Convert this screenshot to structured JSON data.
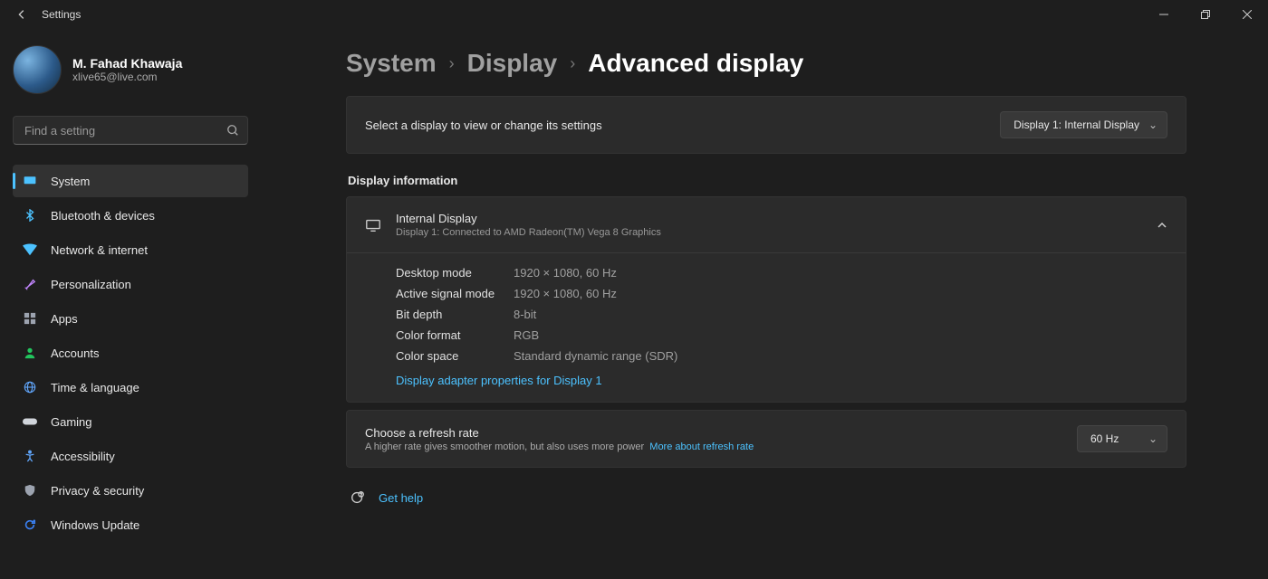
{
  "titlebar": {
    "title": "Settings"
  },
  "profile": {
    "name": "M. Fahad Khawaja",
    "email": "xlive65@live.com"
  },
  "search": {
    "placeholder": "Find a setting"
  },
  "nav": [
    {
      "id": "system",
      "label": "System",
      "active": true,
      "color": "#4cc2ff",
      "icon": "monitor"
    },
    {
      "id": "bluetooth",
      "label": "Bluetooth & devices",
      "color": "#4cc2ff",
      "icon": "bluetooth"
    },
    {
      "id": "network",
      "label": "Network & internet",
      "color": "#4cc2ff",
      "icon": "wifi"
    },
    {
      "id": "personalization",
      "label": "Personalization",
      "color": "#c084fc",
      "icon": "brush"
    },
    {
      "id": "apps",
      "label": "Apps",
      "color": "#9ca3af",
      "icon": "apps"
    },
    {
      "id": "accounts",
      "label": "Accounts",
      "color": "#22c55e",
      "icon": "person"
    },
    {
      "id": "time",
      "label": "Time & language",
      "color": "#60a5fa",
      "icon": "globe"
    },
    {
      "id": "gaming",
      "label": "Gaming",
      "color": "#d1d5db",
      "icon": "gamepad"
    },
    {
      "id": "accessibility",
      "label": "Accessibility",
      "color": "#60a5fa",
      "icon": "accessibility"
    },
    {
      "id": "privacy",
      "label": "Privacy & security",
      "color": "#9ca3af",
      "icon": "shield"
    },
    {
      "id": "update",
      "label": "Windows Update",
      "color": "#3b82f6",
      "icon": "update"
    }
  ],
  "breadcrumbs": {
    "crumb1": "System",
    "crumb2": "Display",
    "current": "Advanced display"
  },
  "display_select": {
    "label": "Select a display to view or change its settings",
    "value": "Display 1: Internal Display"
  },
  "section": {
    "info_title": "Display information"
  },
  "display_info": {
    "title": "Internal Display",
    "subtitle": "Display 1: Connected to AMD Radeon(TM) Vega 8 Graphics",
    "rows": {
      "desktop_mode_k": "Desktop mode",
      "desktop_mode_v": "1920 × 1080, 60 Hz",
      "active_signal_k": "Active signal mode",
      "active_signal_v": "1920 × 1080, 60 Hz",
      "bit_depth_k": "Bit depth",
      "bit_depth_v": "8-bit",
      "color_format_k": "Color format",
      "color_format_v": "RGB",
      "color_space_k": "Color space",
      "color_space_v": "Standard dynamic range (SDR)"
    },
    "adapter_link": "Display adapter properties for Display 1"
  },
  "refresh": {
    "title": "Choose a refresh rate",
    "subtitle": "A higher rate gives smoother motion, but also uses more power",
    "more_link": "More about refresh rate",
    "value": "60 Hz"
  },
  "help": {
    "label": "Get help"
  }
}
